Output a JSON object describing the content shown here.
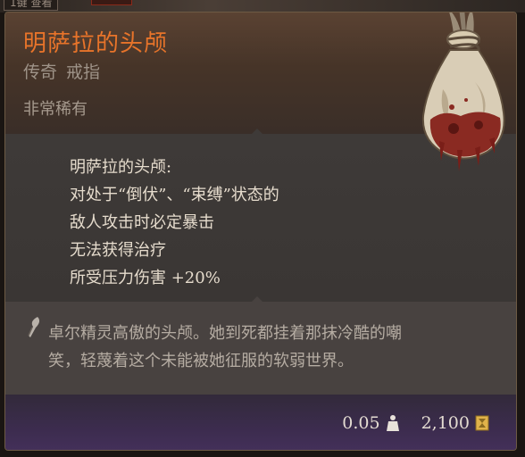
{
  "background": {
    "hotkey_label": "1键 查看"
  },
  "item": {
    "name": "明萨拉的头颅",
    "rarity_label": "传奇",
    "type_label": "戒指",
    "unique_label": "非常稀有",
    "image_icon": "severed-head-in-sack-icon"
  },
  "effects": {
    "heading": "明萨拉的头颅:",
    "lines": [
      "对处于“倒伏”、“束缚”状态的",
      "敌人攻击时必定暴击",
      "无法获得治疗",
      "所受压力伤害 +20%"
    ]
  },
  "lore": {
    "icon": "quill-icon",
    "text_line1": "卓尔精灵高傲的头颅。她到死都挂着那抹冷酷的嘲",
    "text_line2": "笑，轻蔑着这个未能被她征服的软弱世界。"
  },
  "footer": {
    "weight": "0.05",
    "weight_icon": "weight-icon",
    "value": "2,100",
    "value_icon": "gold-coin-icon"
  },
  "colors": {
    "title": "#e8742a",
    "effect_text": "#e6dccd",
    "lore_text": "#b5aca2",
    "border": "#6d5a44"
  }
}
